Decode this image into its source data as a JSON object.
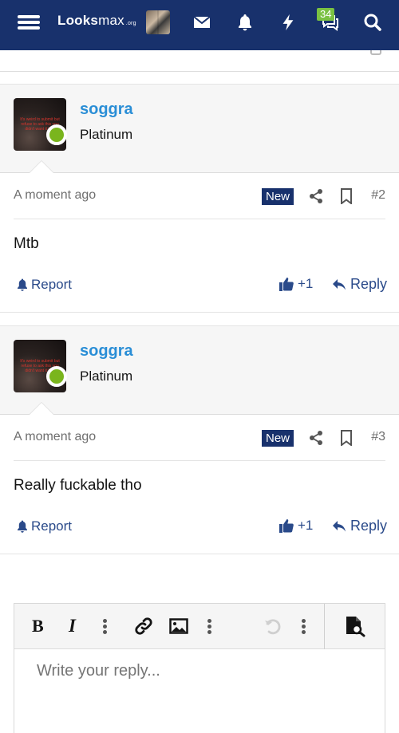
{
  "nav": {
    "logo_bold": "L",
    "logo_mid": "ooks",
    "logo_light": "max",
    "logo_suffix": ".org",
    "alerts_badge": "34",
    "icons": [
      "menu-icon",
      "avatar",
      "mail-icon",
      "bell-icon",
      "lightning-icon",
      "chat-icon",
      "search-icon"
    ]
  },
  "posts": [
    {
      "username": "soggra",
      "user_title": "Platinum",
      "avatar_text": "It's weird to submit but refuse to ask this you didn't want it bad",
      "time": "A moment ago",
      "new_label": "New",
      "post_number": "#2",
      "body": "Mtb",
      "report_label": "Report",
      "like_label": "+1",
      "reply_label": "Reply"
    },
    {
      "username": "soggra",
      "user_title": "Platinum",
      "avatar_text": "It's weird to submit but refuse to ask this you didn't want it bad",
      "time": "A moment ago",
      "new_label": "New",
      "post_number": "#3",
      "body": "Really fuckable tho",
      "report_label": "Report",
      "like_label": "+1",
      "reply_label": "Reply"
    }
  ],
  "editor": {
    "placeholder": "Write your reply...",
    "bold_label": "B",
    "italic_label": "I"
  },
  "colors": {
    "nav_bg": "#18316c",
    "link": "#2a8ed6",
    "action": "#2a4a8a",
    "online": "#7ab51d",
    "badge": "#7ac142"
  }
}
